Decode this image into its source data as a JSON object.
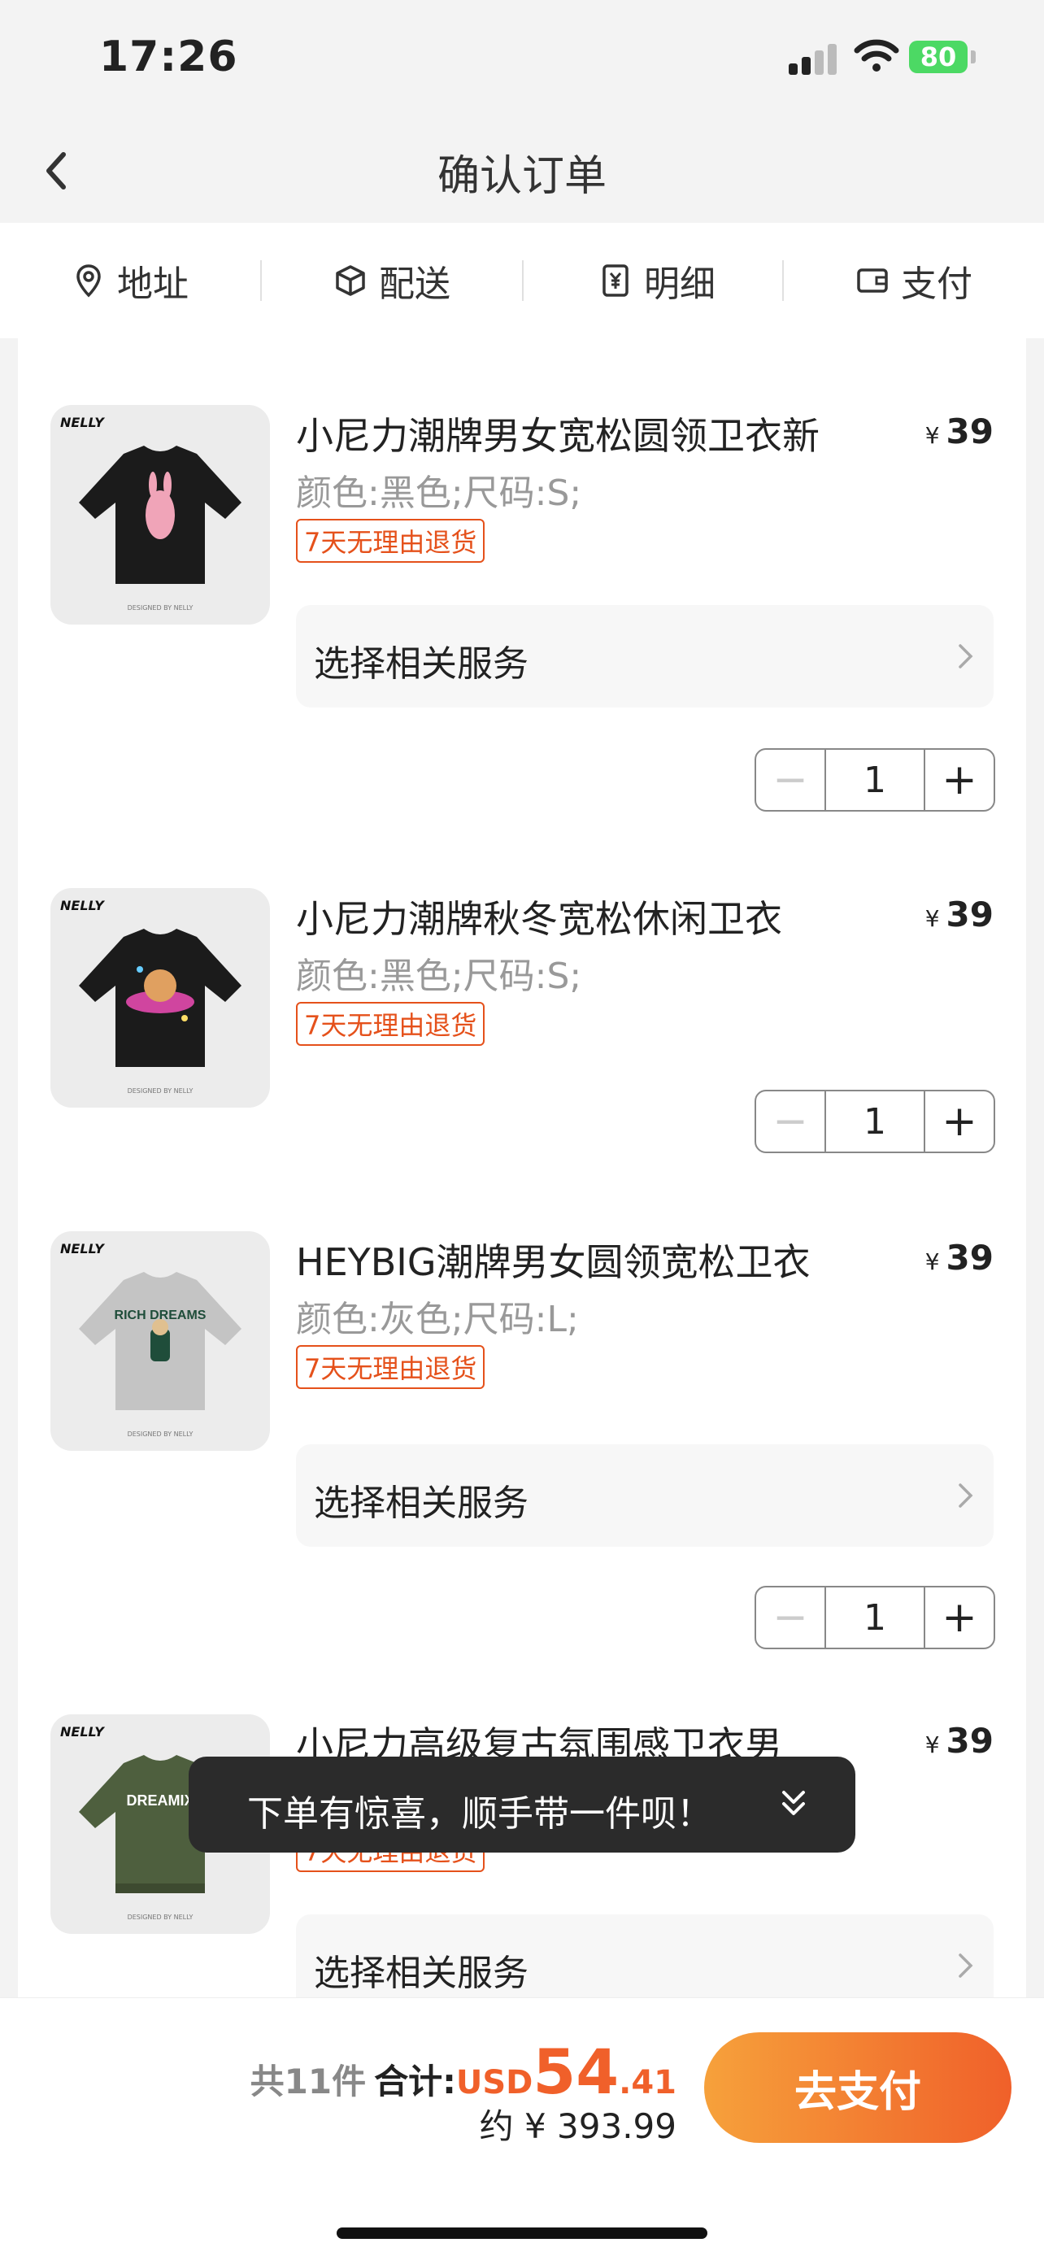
{
  "status_bar": {
    "time": "17:26",
    "battery": "80"
  },
  "nav": {
    "title": "确认订单"
  },
  "steps": [
    {
      "label": "地址",
      "icon": "location-icon"
    },
    {
      "label": "配送",
      "icon": "package-icon"
    },
    {
      "label": "明细",
      "icon": "yen-receipt-icon"
    },
    {
      "label": "支付",
      "icon": "wallet-icon"
    }
  ],
  "items": [
    {
      "title": "小尼力潮牌男女宽松圆领卫衣新",
      "currency": "¥",
      "price": "39",
      "spec": "颜色:黑色;尺码:S;",
      "tag": "7天无理由退货",
      "service": "选择相关服务",
      "qty": "1",
      "thumb_brand": "NELLY",
      "thumb_color": "#1b1b1b"
    },
    {
      "title": "小尼力潮牌秋冬宽松休闲卫衣",
      "currency": "¥",
      "price": "39",
      "spec": "颜色:黑色;尺码:S;",
      "tag": "7天无理由退货",
      "qty": "1",
      "thumb_brand": "NELLY",
      "thumb_color": "#1b1b1b"
    },
    {
      "title": "HEYBIG潮牌男女圆领宽松卫衣",
      "currency": "¥",
      "price": "39",
      "spec": "颜色:灰色;尺码:L;",
      "tag": "7天无理由退货",
      "service": "选择相关服务",
      "qty": "1",
      "thumb_brand": "NELLY",
      "thumb_color": "#c4c4c4",
      "thumb_text": "RICH DREAMS"
    },
    {
      "title": "小尼力高级复古氛围感卫衣男",
      "currency": "¥",
      "price": "39",
      "tag": "7天无理由退货",
      "service": "选择相关服务",
      "thumb_brand": "NELLY",
      "thumb_color": "#4e5f3e",
      "thumb_text": "DREAMIX"
    }
  ],
  "toast": {
    "text": "下单有惊喜，顺手带一件呗！"
  },
  "footer": {
    "count": "共11件",
    "total_label": "合计:",
    "currency": "USD",
    "total_int": "54",
    "total_dec": ".41",
    "approx": "约 ¥ 393.99",
    "pay_label": "去支付"
  },
  "colors": {
    "accent": "#f0602a",
    "accent_start": "#f6a13b",
    "tag": "#e5511b"
  }
}
